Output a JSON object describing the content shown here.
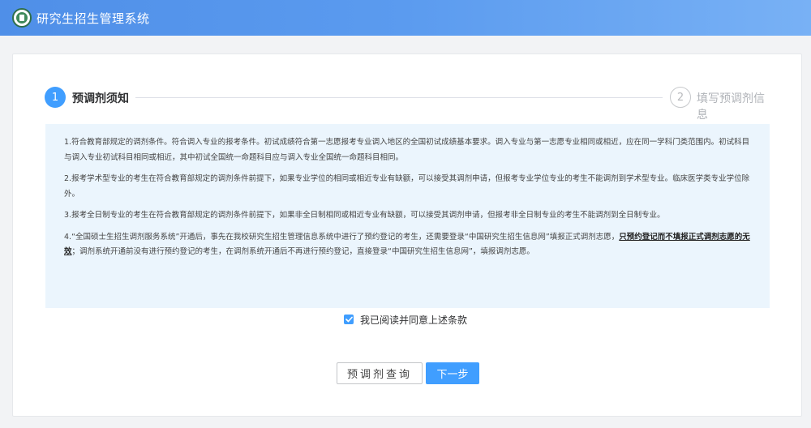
{
  "header": {
    "logo_icon": "university-seal-icon",
    "title": "研究生招生管理系统"
  },
  "steps": [
    {
      "number": "1",
      "label": "预调剂须知",
      "state": "active"
    },
    {
      "number": "2",
      "label": "填写预调剂信息",
      "state": "pending"
    }
  ],
  "notice": {
    "p1": "1.符合教育部规定的调剂条件。符合调入专业的报考条件。初试成绩符合第一志愿报考专业调入地区的全国初试成绩基本要求。调入专业与第一志愿专业相同或相近，应在同一学科门类范围内。初试科目与调入专业初试科目相同或相近，其中初试全国统一命题科目应与调入专业全国统一命题科目相同。",
    "p2": "2.报考学术型专业的考生在符合教育部规定的调剂条件前提下，如果专业学位的相同或相近专业有缺额，可以接受其调剂申请，但报考专业学位专业的考生不能调剂到学术型专业。临床医学类专业学位除外。",
    "p3": "3.报考全日制专业的考生在符合教育部规定的调剂条件前提下，如果非全日制相同或相近专业有缺额，可以接受其调剂申请，但报考非全日制专业的考生不能调剂到全日制专业。",
    "p4_a": "4.“全国硕士生招生调剂服务系统”开通后，事先在我校研究生招生管理信息系统中进行了预约登记的考生，还需要登录“中国研究生招生信息网”填报正式调剂志愿，",
    "p4_strong": "只预约登记而不填报正式调剂志愿的无效",
    "p4_b": "；调剂系统开通前没有进行预约登记的考生，在调剂系统开通后不再进行预约登记，直接登录“中国研究生招生信息网”，填报调剂志愿。"
  },
  "agreement": {
    "checked": true,
    "label": "我已阅读并同意上述条款"
  },
  "buttons": {
    "query": "预调剂查询",
    "next": "下一步"
  },
  "colors": {
    "primary": "#409eff",
    "header_start": "#4f8fe8",
    "header_end": "#78b1f5",
    "notice_bg": "#ebf5fd"
  }
}
